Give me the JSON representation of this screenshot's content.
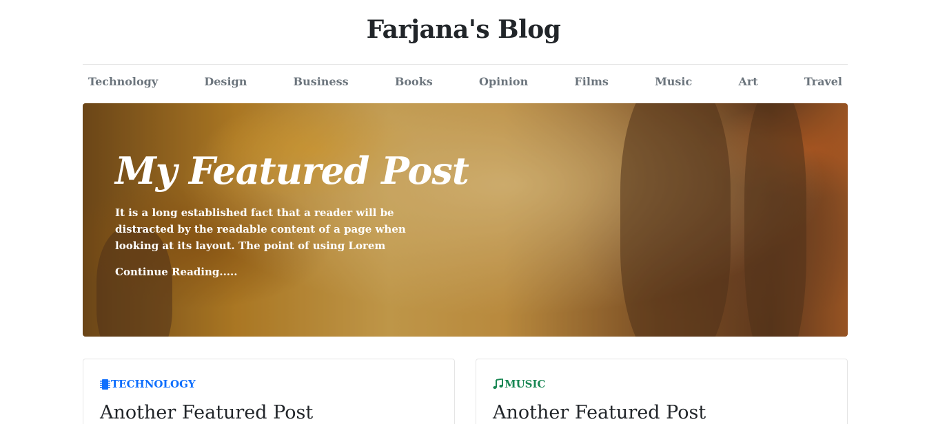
{
  "site": {
    "title": "Farjana's Blog"
  },
  "nav": {
    "items": [
      {
        "label": "Technology"
      },
      {
        "label": "Design"
      },
      {
        "label": "Business"
      },
      {
        "label": "Books"
      },
      {
        "label": "Opinion"
      },
      {
        "label": "Films"
      },
      {
        "label": "Music"
      },
      {
        "label": "Art"
      },
      {
        "label": "Travel"
      }
    ]
  },
  "hero": {
    "title": "My Featured Post",
    "lead": "It is a long established fact that a reader will be distracted by the readable content of a page when looking at its layout. The point of using Lorem",
    "link_label": "Continue Reading....."
  },
  "cards": [
    {
      "category": "TECHNOLOGY",
      "category_icon": "cpu-icon",
      "category_color": "#0d6efd",
      "title": "Another Featured Post"
    },
    {
      "category": "MUSIC",
      "category_icon": "music-note-icon",
      "category_color": "#198754",
      "title": "Another Featured Post"
    }
  ]
}
